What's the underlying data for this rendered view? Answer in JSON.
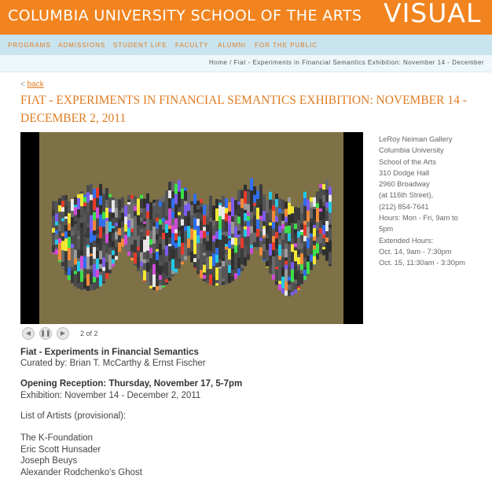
{
  "header": {
    "school": "COLUMBIA UNIVERSITY SCHOOL OF THE ARTS",
    "section": "VISUAL",
    "brand_color": "#f2841f"
  },
  "nav": {
    "items": [
      "PROGRAMS",
      "ADMISSIONS",
      "STUDENT LIFE",
      "FACULTY",
      "ALUMNI",
      "FOR THE PUBLIC"
    ]
  },
  "breadcrumb": "Home / Fiat - Experiments in Financial Semantics Exhibition: November 14 - December",
  "back": {
    "prefix": "<",
    "label": "back"
  },
  "page_title": "FIAT - EXPERIMENTS IN FINANCIAL SEMANTICS EXHIBITION: NOVEMBER 14 - DECEMBER 2, 2011",
  "slideshow": {
    "counter": "2 of 2",
    "prev_icon": "prev-icon",
    "pause_icon": "pause-icon",
    "next_icon": "next-icon"
  },
  "gallery_info": [
    "LeRoy Neiman Gallery",
    "Columbia University",
    "School of the Arts",
    "310 Dodge Hall",
    "2960 Broadway",
    "(at 116th Street),",
    "(212) 854-7641",
    "Hours: Mon - Fri, 9am to",
    "5pm",
    "Extended Hours:",
    "Oct. 14, 9am - 7:30pm",
    "Oct. 15, 11:30am - 3:30pm"
  ],
  "content": {
    "exhibit_title": "Fiat - Experiments in Financial Semantics",
    "curated": "Curated by: Brian T. McCarthy & Ernst Fischer",
    "reception": "Opening Reception: Thursday, November 17, 5-7pm",
    "exhibition": "Exhibition: November 14 - December 2, 2011",
    "artists_heading": "List of Artists (provisional):",
    "artists": [
      "The K-Foundation",
      "Eric Scott Hunsader",
      "Joseph Beuys",
      "Alexander Rodchenko's Ghost"
    ]
  }
}
